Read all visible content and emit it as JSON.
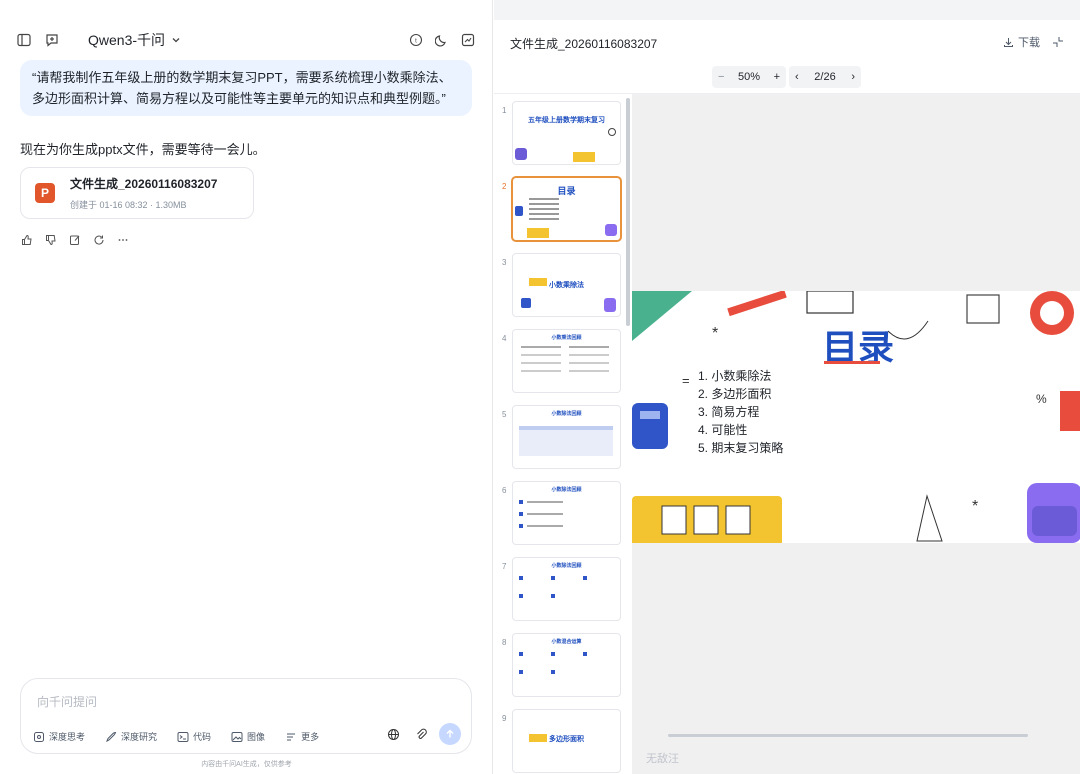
{
  "window": {
    "controls": [
      "minimize",
      "maximize",
      "close"
    ]
  },
  "chat": {
    "model_name": "Qwen3-千问",
    "user_message": "“请帮我制作五年级上册的数学期末复习PPT，需要系统梳理小数乘除法、多边形面积计算、简易方程以及可能性等主要单元的知识点和典型例题。”",
    "assistant_message": "现在为你生成pptx文件，需要等待一会儿。",
    "file_card": {
      "icon_letter": "P",
      "name": "文件生成_20260116083207",
      "meta": "创建于 01-16 08:32 · 1.30MB"
    },
    "composer": {
      "placeholder": "向千问提问",
      "tools": [
        "深度思考",
        "深度研究",
        "代码",
        "图像",
        "更多"
      ]
    },
    "disclaimer": "内容由千问AI生成，仅供参考"
  },
  "preview": {
    "title": "文件生成_20260116083207",
    "download_label": "下载",
    "zoom": "50%",
    "page_indicator": "2/26",
    "thumbnails": [
      {
        "num": "1",
        "title": "五年级上册数学期末复习",
        "active": false
      },
      {
        "num": "2",
        "title": "目录",
        "active": true
      },
      {
        "num": "3",
        "title": "小数乘除法",
        "active": false
      },
      {
        "num": "4",
        "title": "小数乘法回顾",
        "active": false
      },
      {
        "num": "5",
        "title": "小数除法回顾",
        "active": false
      },
      {
        "num": "6",
        "title": "小数除法回顾",
        "active": false
      },
      {
        "num": "7",
        "title": "小数除法回顾",
        "active": false
      },
      {
        "num": "8",
        "title": "小数混合运算",
        "active": false
      },
      {
        "num": "9",
        "title": "多边形面积",
        "active": false
      }
    ],
    "slide": {
      "title": "目录",
      "items": [
        "1. 小数乘除法",
        "2. 多边形面积",
        "3. 简易方程",
        "4. 可能性",
        "5. 期末复习策略"
      ]
    },
    "watermark": "无敌汪"
  }
}
